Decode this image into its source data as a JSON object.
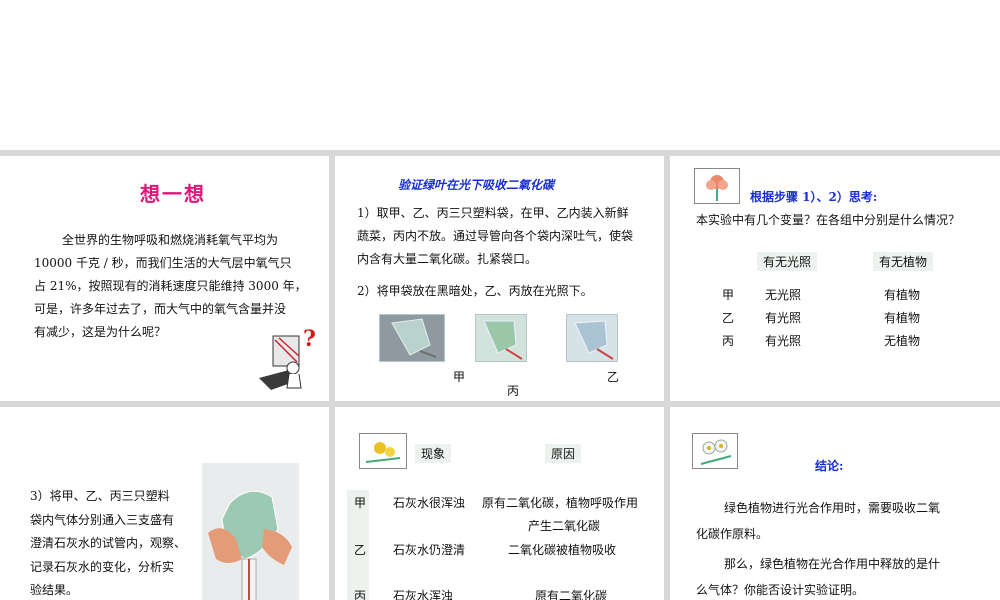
{
  "panel1": {
    "title": "想一想",
    "lines": [
      "全世界的生物呼吸和燃烧消耗氧气平均为",
      "10000 千克 / 秒，而我们生活的大气层中氧气只",
      "占 21%，按照现有的消耗速度只能维持 3000 年，",
      "可是，许多年过去了，而大气中的氧气含量并没",
      "有减少，这是为什么呢？"
    ],
    "question_mark": "?"
  },
  "panel2": {
    "title": "验证绿叶在光下吸收二氧化碳",
    "step1_lines": [
      "1）取甲、乙、丙三只塑料袋，在甲、乙内装入新鲜",
      "蔬菜，丙内不放。通过导管向各个袋内深吐气，使袋",
      "内含有大量二氧化碳。扎紧袋口。"
    ],
    "step2": "2）将甲袋放在黑暗处，乙、丙放在光照下。",
    "label_jia": "甲",
    "label_yi": "乙",
    "label_bing": "丙"
  },
  "panel3": {
    "heading": "根据步骤 1）、2）思考:",
    "question": "本实验中有几个变量？在各组中分别是什么情况？",
    "col_headers": [
      "有无光照",
      "有无植物"
    ],
    "rows": [
      {
        "label": "甲",
        "light": "无光照",
        "plant": "有植物"
      },
      {
        "label": "乙",
        "light": "有光照",
        "plant": "有植物"
      },
      {
        "label": "丙",
        "light": "有光照",
        "plant": "无植物"
      }
    ]
  },
  "panel4": {
    "lines": [
      "3）将甲、乙、丙三只塑料",
      "袋内气体分别通入三支盛有",
      "澄清石灰水的试管内，观察、",
      "记录石灰水的变化，分析实",
      "验结果。"
    ]
  },
  "panel5": {
    "col_headers": [
      "现象",
      "原因"
    ],
    "rows": [
      {
        "label": "甲",
        "phenomenon": "石灰水很浑浊",
        "reason": "原有二氧化碳，植物呼吸作用",
        "reason2": "产生二氧化碳"
      },
      {
        "label": "乙",
        "phenomenon": "石灰水仍澄清",
        "reason": "二氧化碳被植物吸收",
        "reason2": ""
      },
      {
        "label": "丙",
        "phenomenon": "石灰水浑浊",
        "reason": "原有二氧化碳",
        "reason2": ""
      }
    ]
  },
  "panel6": {
    "heading": "结论:",
    "para1_lines": [
      "绿色植物进行光合作用时，需要吸收二氧",
      "化碳作原料。"
    ],
    "para2_lines": [
      "那么，绿色植物在光合作用中释放的是什",
      "么气体？你能否设计实验证明。"
    ]
  },
  "colors": {
    "pink_title": "#e0177a",
    "blue_title": "#1a2fd1",
    "divider": "#d8d8d8"
  }
}
